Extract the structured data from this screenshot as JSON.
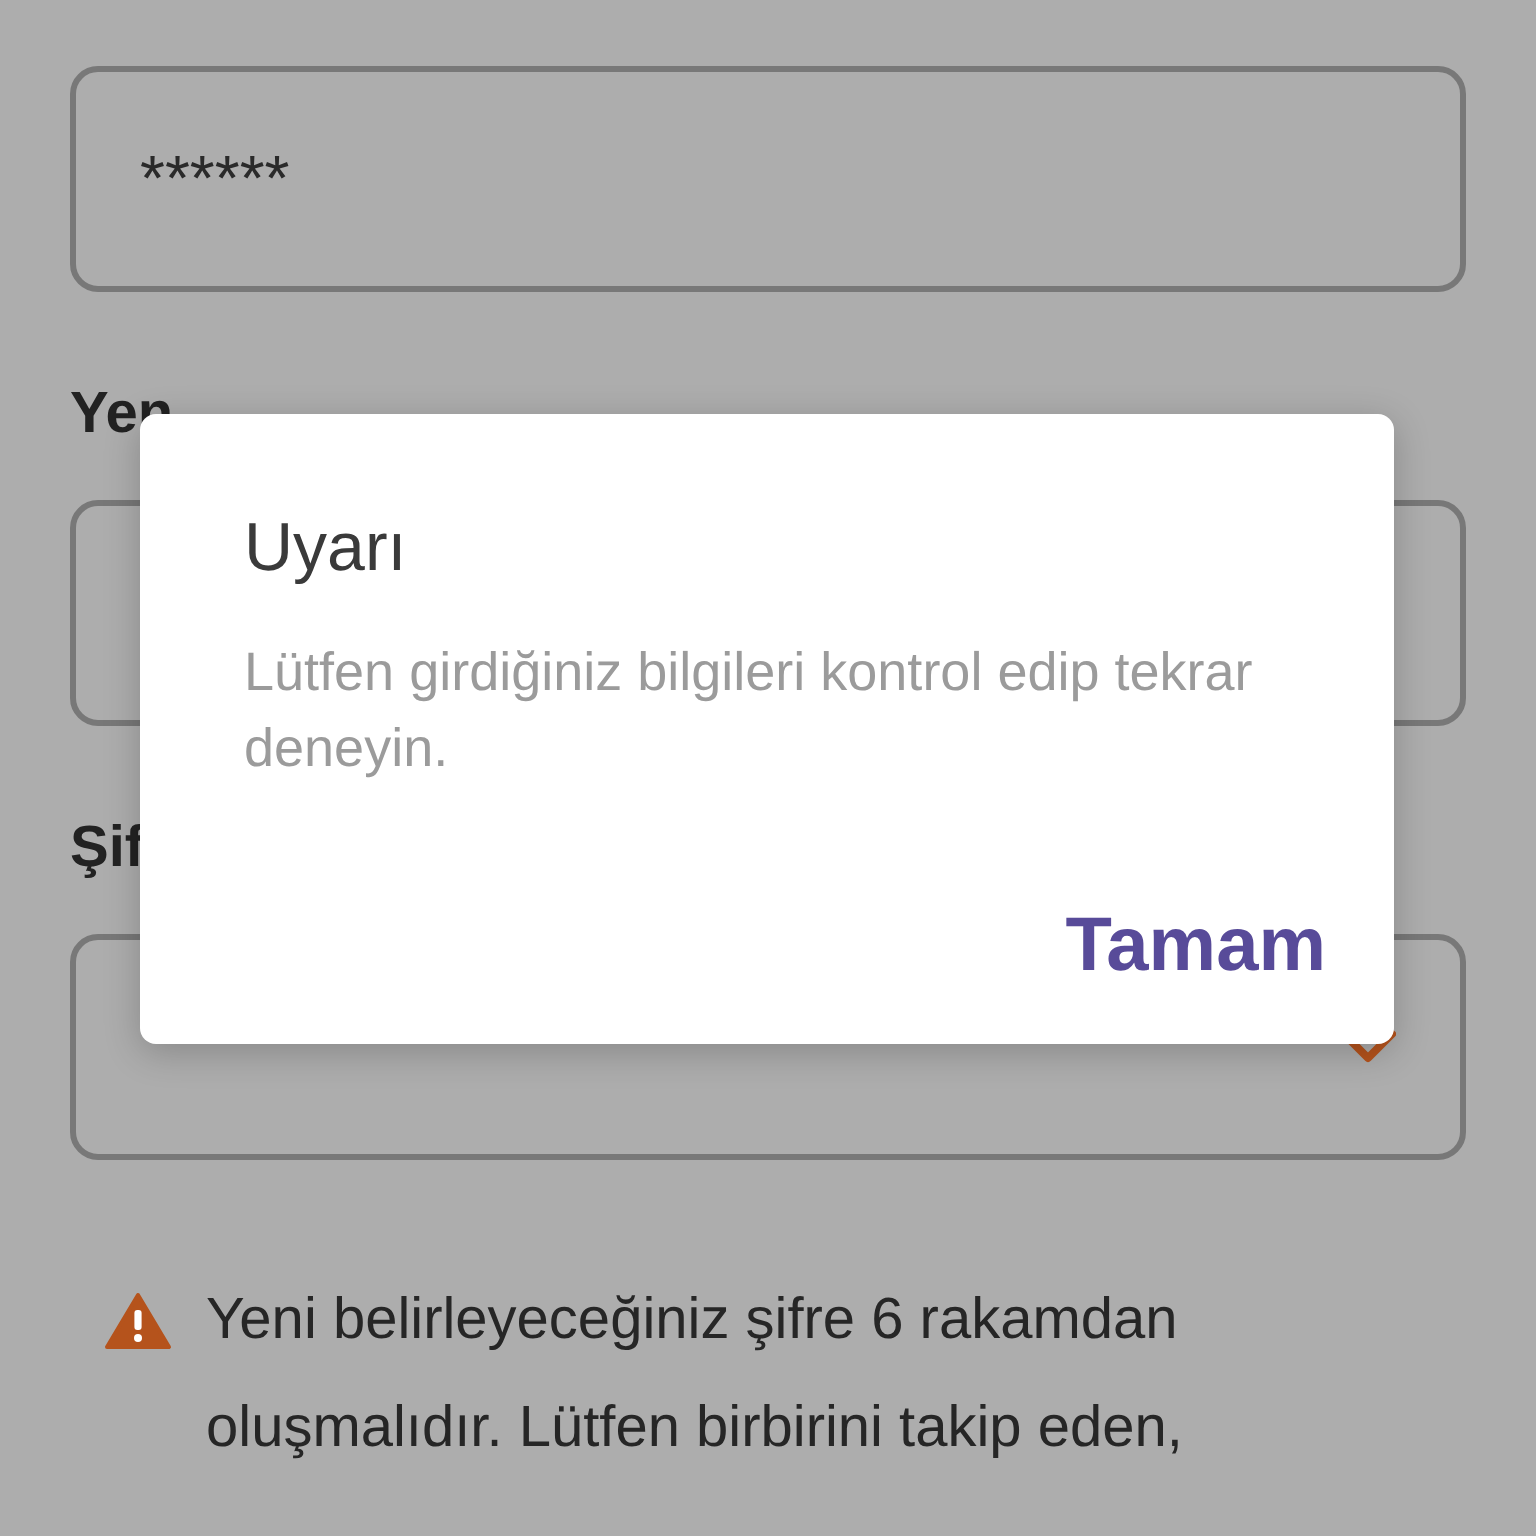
{
  "form": {
    "fields": [
      {
        "kind": "password",
        "value": "******"
      },
      {
        "kind": "password",
        "label": "Yen"
      },
      {
        "kind": "select",
        "label": "Şif"
      }
    ]
  },
  "notice": {
    "text": "Yeni belirleyeceğiniz şifre 6 rakamdan oluşmalıdır. Lütfen birbirini takip eden,"
  },
  "dialog": {
    "title": "Uyarı",
    "message": "Lütfen girdiğiniz bilgileri kontrol edip tekrar deneyin.",
    "buttons": [
      "Tamam"
    ]
  }
}
